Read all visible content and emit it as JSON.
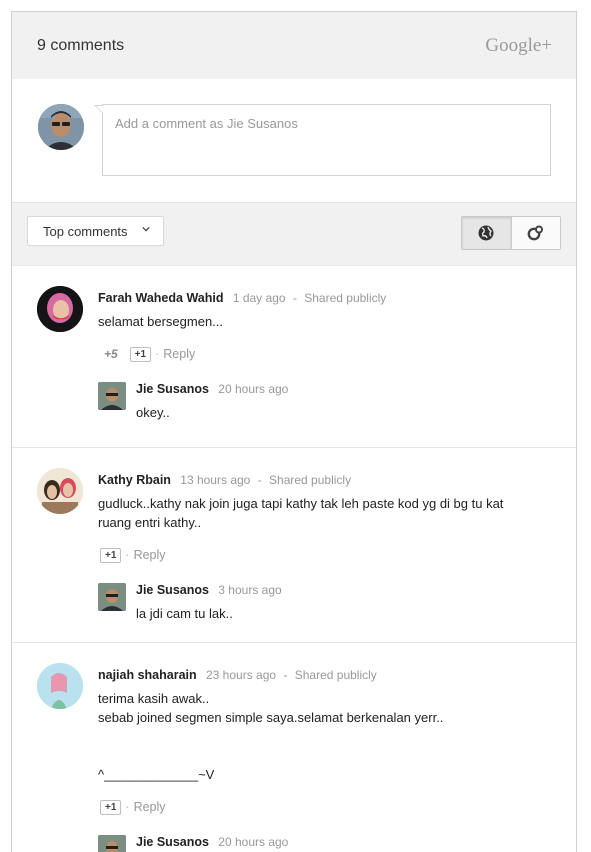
{
  "header": {
    "count_label": "9 comments",
    "brand": "Google+"
  },
  "compose": {
    "placeholder": "Add a comment as Jie Susanos"
  },
  "toolbar": {
    "sort_label": "Top comments",
    "view_icons": [
      "globe-icon",
      "circles-icon"
    ]
  },
  "comments": [
    {
      "author": "Farah Waheda Wahid",
      "time": "1 day ago",
      "visibility": "Shared publicly",
      "text": "selamat bersegmen...",
      "plus_count": "+5",
      "plus_label": "+1",
      "reply_label": "Reply",
      "reply": {
        "author": "Jie Susanos",
        "time": "20 hours ago",
        "text": "okey.."
      }
    },
    {
      "author": "Kathy Rbain",
      "time": "13 hours ago",
      "visibility": "Shared publicly",
      "text": "gudluck..kathy nak join juga tapi kathy tak leh paste kod yg di bg tu kat ruang entri kathy..",
      "plus_label": "+1",
      "reply_label": "Reply",
      "reply": {
        "author": "Jie Susanos",
        "time": "3 hours ago",
        "text": "la jdi cam tu lak.."
      }
    },
    {
      "author": "najiah shaharain",
      "time": "23 hours ago",
      "visibility": "Shared publicly",
      "text_lines": [
        "terima kasih awak..",
        "sebab joined segmen simple saya.selamat berkenalan yerr..",
        "",
        "",
        "^_____________~V"
      ],
      "plus_label": "+1",
      "reply_label": "Reply",
      "reply": {
        "author": "Jie Susanos",
        "time": "20 hours ago"
      }
    }
  ]
}
